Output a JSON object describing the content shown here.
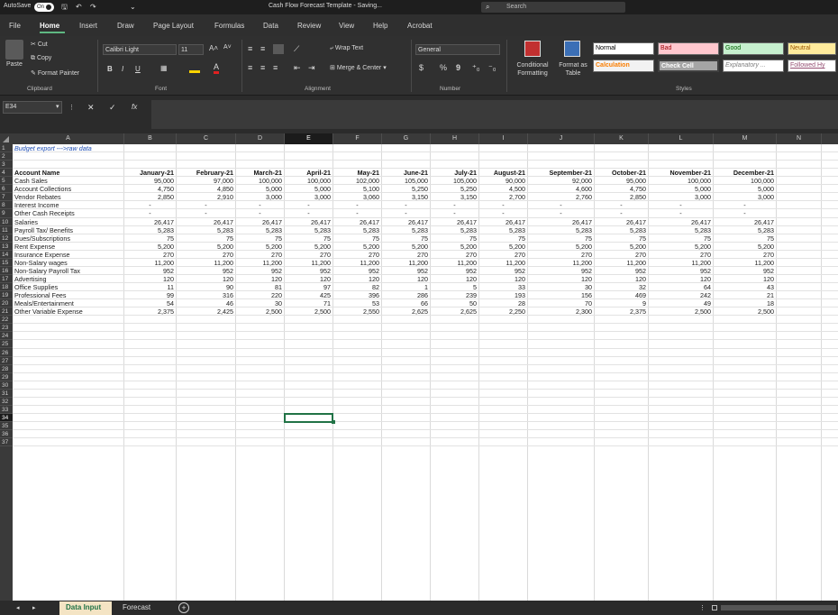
{
  "titlebar": {
    "autosave": "AutoSave",
    "toggle": "On",
    "title": "Cash Flow Forecast Template - Saving...",
    "search": "Search"
  },
  "menu": [
    "File",
    "Home",
    "Insert",
    "Draw",
    "Page Layout",
    "Formulas",
    "Data",
    "Review",
    "View",
    "Help",
    "Acrobat"
  ],
  "ribbon": {
    "clipboard": {
      "paste": "Paste",
      "cut": "Cut",
      "copy": "Copy",
      "format_painter": "Format Painter",
      "label": "Clipboard"
    },
    "font": {
      "name": "Calibri Light",
      "size": "11",
      "label": "Font",
      "bold": "B",
      "italic": "I",
      "underline": "U"
    },
    "alignment": {
      "wrap": "Wrap Text",
      "merge": "Merge & Center",
      "label": "Alignment"
    },
    "number": {
      "format": "General",
      "currency": "$",
      "percent": "%",
      "comma": "9",
      "label": "Number"
    },
    "styles": {
      "conditional": "Conditional Formatting",
      "format_table": "Format as Table",
      "label": "Styles",
      "cells": [
        {
          "name": "Normal",
          "bg": "#ffffff",
          "fg": "#000000"
        },
        {
          "name": "Bad",
          "bg": "#ffc7ce",
          "fg": "#9c0006"
        },
        {
          "name": "Good",
          "bg": "#c6efce",
          "fg": "#006100"
        },
        {
          "name": "Neutral",
          "bg": "#ffeb9c",
          "fg": "#9c5700"
        },
        {
          "name": "Calculation",
          "bg": "#f2f2f2",
          "fg": "#fa7d00"
        },
        {
          "name": "Check Cell",
          "bg": "#a5a5a5",
          "fg": "#ffffff"
        },
        {
          "name": "Explanatory ...",
          "bg": "#ffffff",
          "fg": "#7f7f7f"
        },
        {
          "name": "Followed Hy",
          "bg": "#ffffff",
          "fg": "#954f72"
        }
      ]
    }
  },
  "namebox": "E34",
  "fx": "fx",
  "columns": [
    "A",
    "B",
    "C",
    "D",
    "E",
    "F",
    "G",
    "H",
    "I",
    "J",
    "K",
    "L",
    "M",
    "N"
  ],
  "rows": [
    "1",
    "2",
    "3",
    "4",
    "5",
    "6",
    "7",
    "8",
    "9",
    "10",
    "11",
    "12",
    "13",
    "14",
    "15",
    "16",
    "17",
    "18",
    "19",
    "20",
    "21",
    "22",
    "23",
    "24",
    "25",
    "26",
    "27",
    "28",
    "29",
    "30",
    "31",
    "32",
    "33",
    "34",
    "35",
    "36",
    "37"
  ],
  "sheet": {
    "note": "Budget export --->raw data",
    "header": [
      "Account Name",
      "January-21",
      "February-21",
      "March-21",
      "April-21",
      "May-21",
      "June-21",
      "July-21",
      "August-21",
      "September-21",
      "October-21",
      "November-21",
      "December-21"
    ],
    "data": [
      [
        "Cash Sales",
        "95,000",
        "97,000",
        "100,000",
        "100,000",
        "102,000",
        "105,000",
        "105,000",
        "90,000",
        "92,000",
        "95,000",
        "100,000",
        "100,000"
      ],
      [
        "Account Collections",
        "4,750",
        "4,850",
        "5,000",
        "5,000",
        "5,100",
        "5,250",
        "5,250",
        "4,500",
        "4,600",
        "4,750",
        "5,000",
        "5,000"
      ],
      [
        "Vendor Rebates",
        "2,850",
        "2,910",
        "3,000",
        "3,000",
        "3,060",
        "3,150",
        "3,150",
        "2,700",
        "2,760",
        "2,850",
        "3,000",
        "3,000"
      ],
      [
        "Interest Income",
        "-",
        "-",
        "-",
        "-",
        "-",
        "-",
        "-",
        "-",
        "-",
        "-",
        "-",
        "-"
      ],
      [
        "Other Cash Receipts",
        "-",
        "-",
        "-",
        "-",
        "-",
        "-",
        "-",
        "-",
        "-",
        "-",
        "-",
        "-"
      ],
      [
        "Salaries",
        "26,417",
        "26,417",
        "26,417",
        "26,417",
        "26,417",
        "26,417",
        "26,417",
        "26,417",
        "26,417",
        "26,417",
        "26,417",
        "26,417"
      ],
      [
        "Payroll Tax/ Benefits",
        "5,283",
        "5,283",
        "5,283",
        "5,283",
        "5,283",
        "5,283",
        "5,283",
        "5,283",
        "5,283",
        "5,283",
        "5,283",
        "5,283"
      ],
      [
        "Dues/Subscriptions",
        "75",
        "75",
        "75",
        "75",
        "75",
        "75",
        "75",
        "75",
        "75",
        "75",
        "75",
        "75"
      ],
      [
        "Rent Expense",
        "5,200",
        "5,200",
        "5,200",
        "5,200",
        "5,200",
        "5,200",
        "5,200",
        "5,200",
        "5,200",
        "5,200",
        "5,200",
        "5,200"
      ],
      [
        "Insurance Expense",
        "270",
        "270",
        "270",
        "270",
        "270",
        "270",
        "270",
        "270",
        "270",
        "270",
        "270",
        "270"
      ],
      [
        "Non-Salary wages",
        "11,200",
        "11,200",
        "11,200",
        "11,200",
        "11,200",
        "11,200",
        "11,200",
        "11,200",
        "11,200",
        "11,200",
        "11,200",
        "11,200"
      ],
      [
        "Non-Salary Payroll Tax",
        "952",
        "952",
        "952",
        "952",
        "952",
        "952",
        "952",
        "952",
        "952",
        "952",
        "952",
        "952"
      ],
      [
        "Advertising",
        "120",
        "120",
        "120",
        "120",
        "120",
        "120",
        "120",
        "120",
        "120",
        "120",
        "120",
        "120"
      ],
      [
        "Office Supplies",
        "11",
        "90",
        "81",
        "97",
        "82",
        "1",
        "5",
        "33",
        "30",
        "32",
        "64",
        "43"
      ],
      [
        "Professional Fees",
        "99",
        "316",
        "220",
        "425",
        "396",
        "286",
        "239",
        "193",
        "156",
        "469",
        "242",
        "21"
      ],
      [
        "Meals/Entertainment",
        "54",
        "46",
        "30",
        "71",
        "53",
        "66",
        "50",
        "28",
        "70",
        "9",
        "49",
        "18"
      ],
      [
        "Other Variable Expense",
        "2,375",
        "2,425",
        "2,500",
        "2,500",
        "2,550",
        "2,625",
        "2,625",
        "2,250",
        "2,300",
        "2,375",
        "2,500",
        "2,500"
      ]
    ]
  },
  "tabs": [
    "Data Input",
    "Forecast"
  ],
  "colors": {
    "accent": "#217346",
    "active_tab": "#f4e4c4",
    "active_tab_text": "#217346",
    "note_text": "#1f4fb6"
  }
}
